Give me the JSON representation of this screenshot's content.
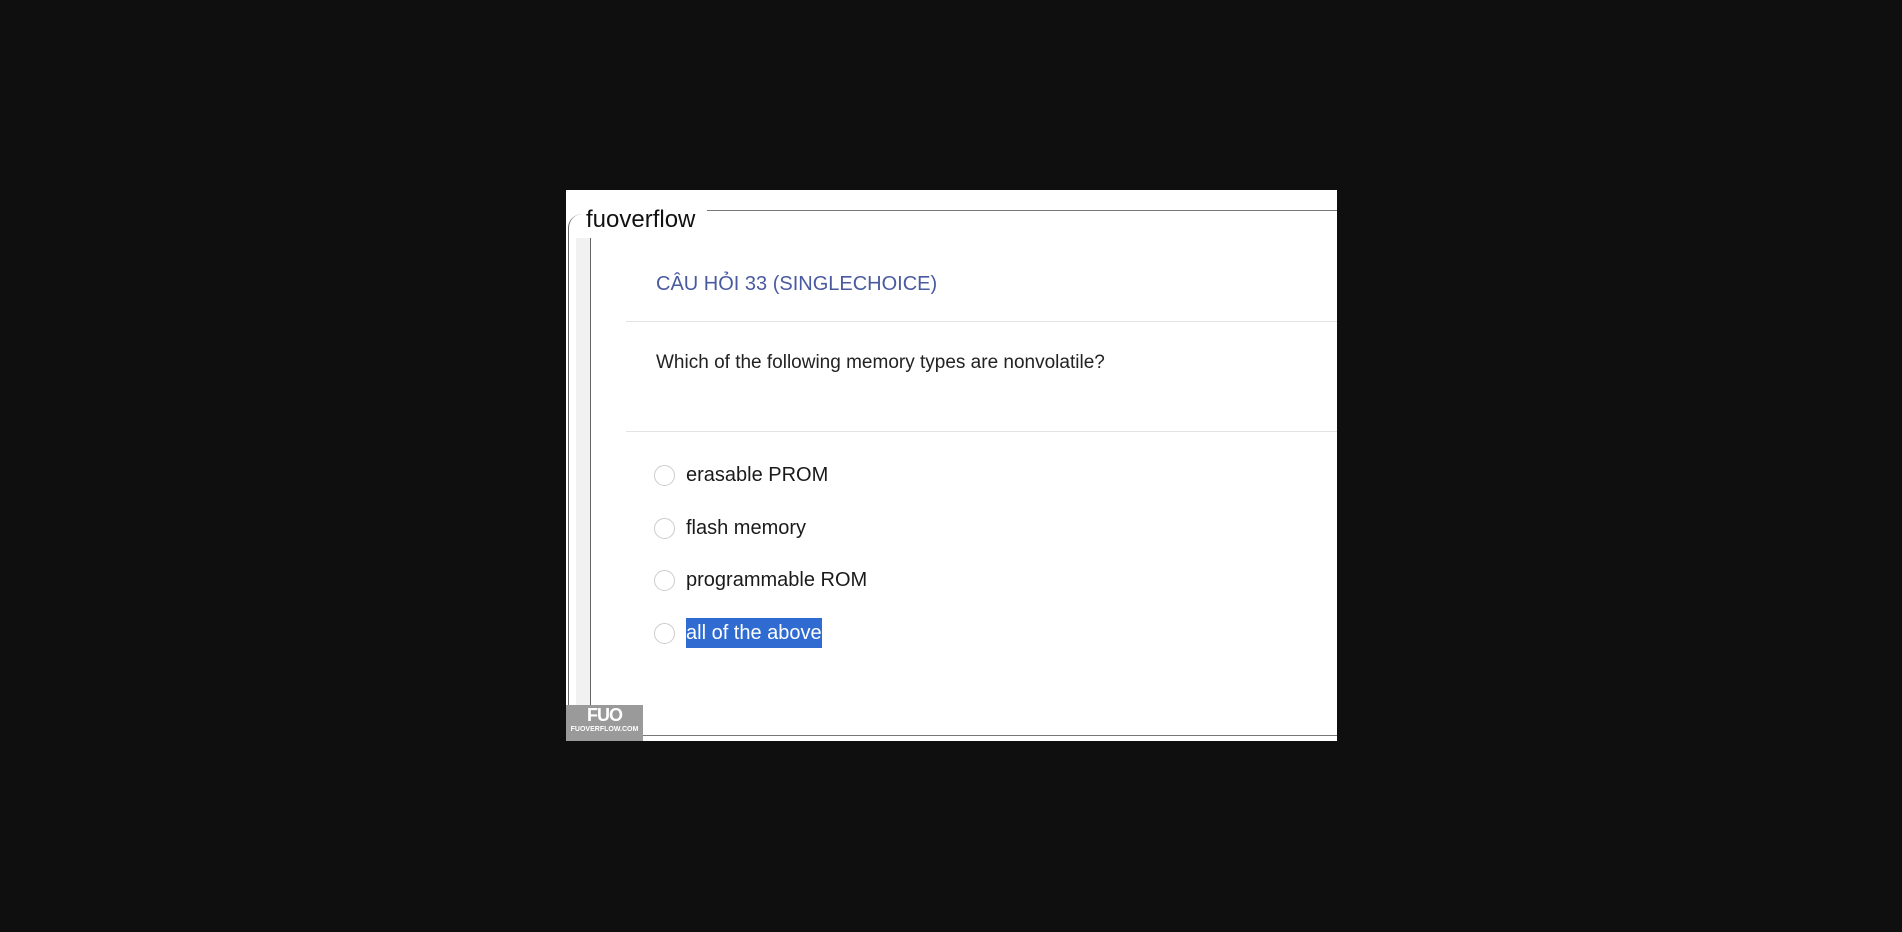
{
  "brand": "fuoverflow",
  "question": {
    "title": "CÂU HỎI 33 (SINGLECHOICE)",
    "text": "Which of the following memory types are nonvolatile?",
    "options": [
      {
        "label": "erasable PROM"
      },
      {
        "label": "flash memory"
      },
      {
        "label": "programmable ROM"
      },
      {
        "label": "all of the above",
        "highlighted": true
      }
    ]
  },
  "watermark": {
    "logo": "FUO",
    "site": "FUOVERFLOW.COM"
  },
  "colors": {
    "title": "#4a5aa0",
    "highlight": "#2f6bd0",
    "background": "#0f0f0f"
  }
}
